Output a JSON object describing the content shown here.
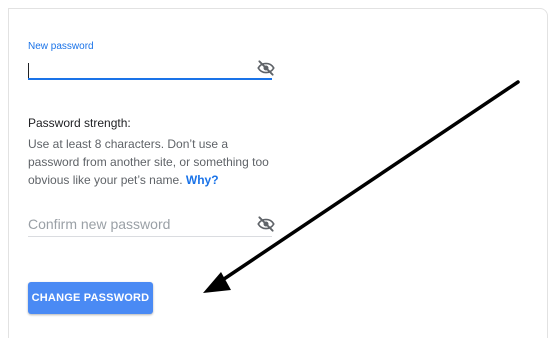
{
  "form": {
    "new_password_label": "New password",
    "new_password_value": "",
    "strength_title": "Password strength:",
    "hint_text": "Use at least 8 characters. Don’t use a password from another site, or something too obvious like your pet’s name. ",
    "why_link": "Why?",
    "confirm_placeholder": "Confirm new password",
    "submit_label": "CHANGE PASSWORD"
  },
  "icons": {
    "new_password_toggle": "eye-slash-icon",
    "confirm_toggle": "eye-slash-icon",
    "annotation": "arrow-annotation"
  },
  "colors": {
    "accent": "#1a73e8",
    "button": "#4a8af4",
    "arrow": "#000000"
  }
}
